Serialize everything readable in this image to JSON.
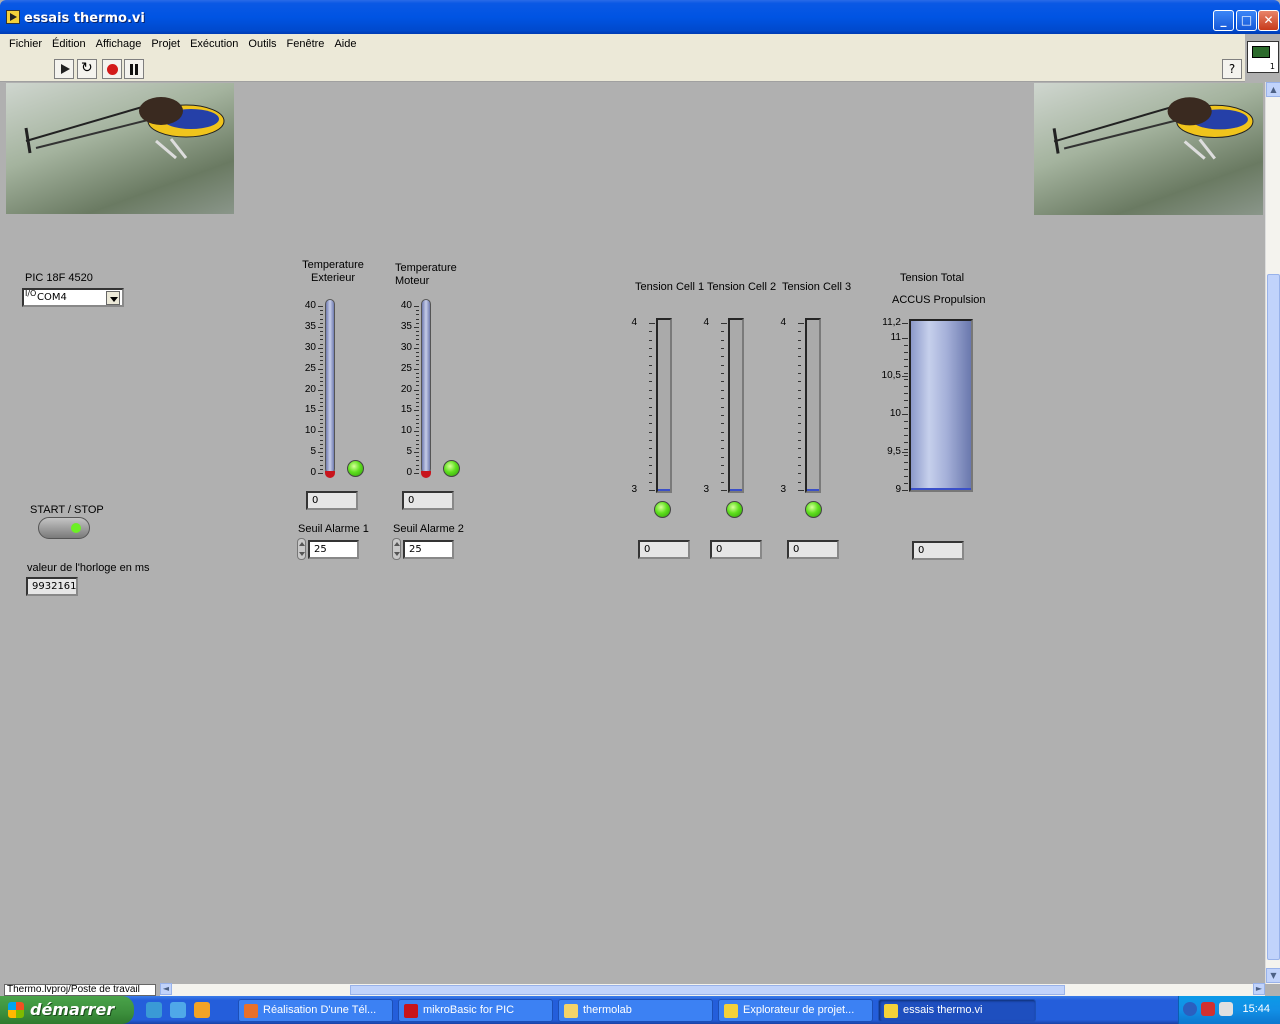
{
  "window": {
    "title": "essais thermo.vi"
  },
  "menu": [
    "Fichier",
    "Édition",
    "Affichage",
    "Projet",
    "Exécution",
    "Outils",
    "Fenêtre",
    "Aide"
  ],
  "toolbar": {
    "help_label": "?",
    "vi_icon_num": "1"
  },
  "panel": {
    "pic_label": "PIC 18F 4520",
    "com": {
      "io": "I/O",
      "value": "COM4"
    },
    "start_stop_label": "START / STOP",
    "clock_label": "valeur de l'horloge en ms",
    "clock_value": "9932161",
    "thermo1": {
      "title_l1": "Temperature",
      "title_l2": "Exterieur",
      "value": "0",
      "level": 0
    },
    "thermo2": {
      "title_l1": "Temperature",
      "title_l2": "Moteur",
      "value": "0",
      "level": 0
    },
    "thermo_ticks": [
      "40",
      "35",
      "30",
      "25",
      "20",
      "15",
      "10",
      "5",
      "0"
    ],
    "alarm1": {
      "label": "Seuil Alarme 1",
      "value": "25"
    },
    "alarm2": {
      "label": "Seuil Alarme 2",
      "value": "25"
    },
    "cell1": {
      "label": "Tension Cell 1",
      "value": "0",
      "max": "4",
      "min": "3",
      "level": 0
    },
    "cell2": {
      "label": "Tension Cell 2",
      "value": "0",
      "max": "4",
      "min": "3",
      "level": 0
    },
    "cell3": {
      "label": "Tension Cell 3",
      "value": "0",
      "max": "4",
      "min": "3",
      "level": 0
    },
    "total": {
      "label_l1": "Tension Total",
      "label_l2": "ACCUS Propulsion",
      "value": "0",
      "ticks": [
        "11,2",
        "11",
        "10,5",
        "10",
        "9,5",
        "9"
      ],
      "level": 0
    }
  },
  "statusbar": {
    "path": "Thermo.lvproj/Poste de travail"
  },
  "taskbar": {
    "start_label": "démarrer",
    "tasks": [
      "Réalisation D'une Tél...",
      "mikroBasic for PIC",
      "thermolab",
      "Explorateur de projet...",
      "essais thermo.vi"
    ],
    "clock": "15:44"
  },
  "colors": {
    "panel": "#b0b0b0",
    "led_on": "#5fe01e",
    "thermo_bulb": "#c8141c",
    "xp_blue": "#245edb"
  }
}
